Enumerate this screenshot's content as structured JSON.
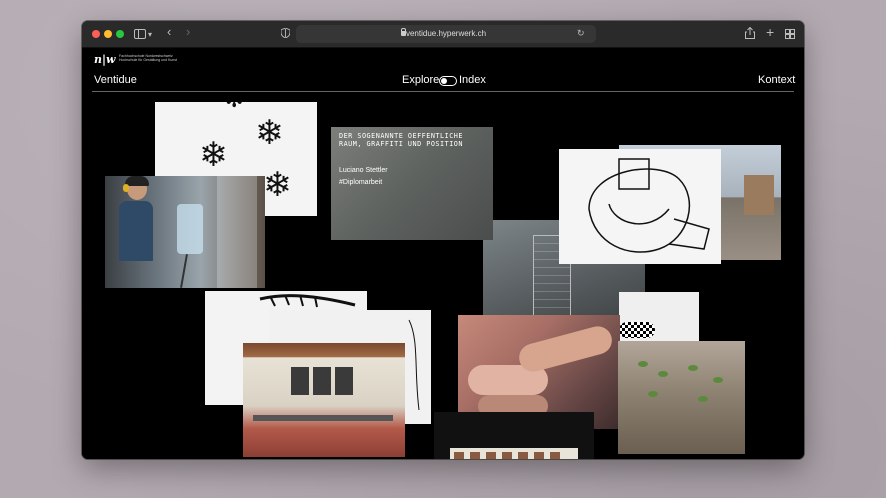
{
  "browser": {
    "url": "ventidue.hyperwerk.ch"
  },
  "site": {
    "logo_mark": "n|w",
    "logo_text": "Fachhochschule Nordwestschweiz Hochschule für Gestaltung und Kunst",
    "title": "Ventidue",
    "nav": {
      "explore": "Explore",
      "index": "Index",
      "kontext": "Kontext"
    }
  },
  "project_card": {
    "title": "DER SOGENANNTE OEFFENTLICHE RAUM, GRAFFITI UND POSITION",
    "author": "Luciano Stettler",
    "tag": "#Diplomarbeit"
  },
  "icons": [
    "sidebar-icon",
    "chevron-down-icon",
    "back-icon",
    "forward-icon",
    "shield-icon",
    "lock-icon",
    "reload-icon",
    "share-icon",
    "plus-icon",
    "tabs-icon"
  ]
}
